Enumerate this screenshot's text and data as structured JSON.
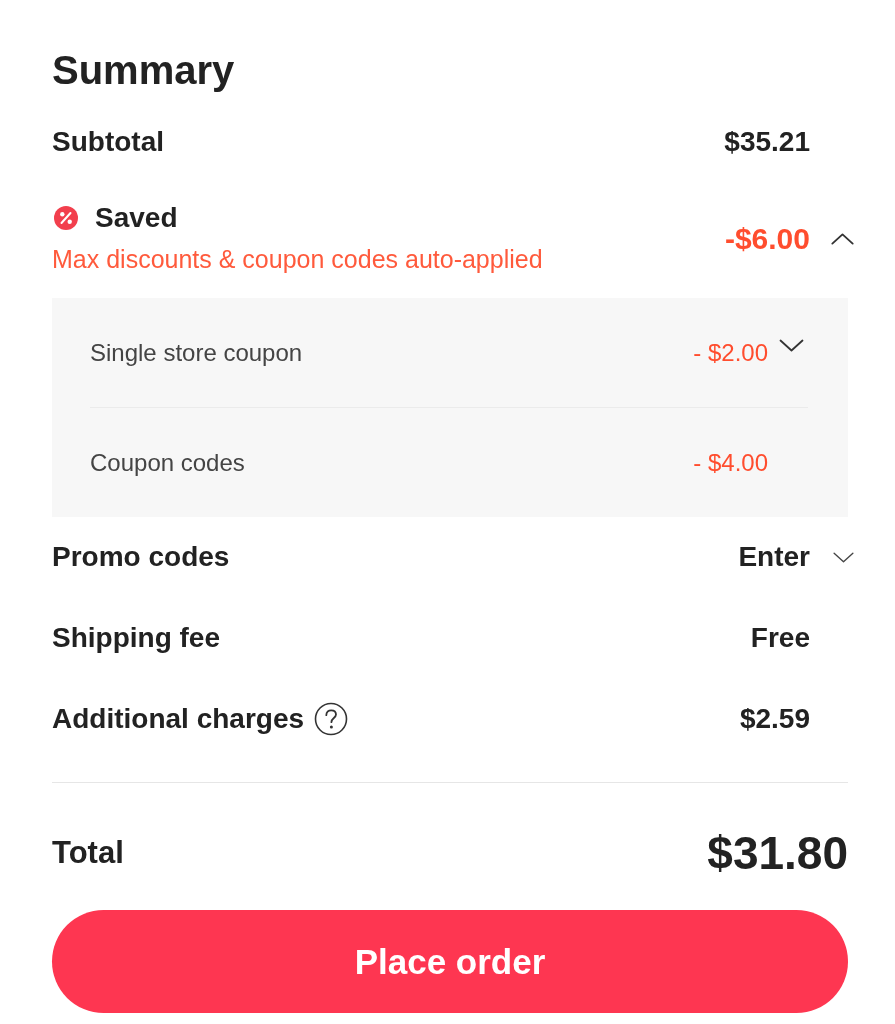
{
  "title": "Summary",
  "subtotal": {
    "label": "Subtotal",
    "value": "$35.21"
  },
  "savings": {
    "label": "Saved",
    "note": "Max discounts & coupon codes auto-applied",
    "value": "-$6.00",
    "expanded": true,
    "items": [
      {
        "kind": "expandable",
        "label": "Single store coupon",
        "value": "- $2.00"
      },
      {
        "kind": "plain",
        "label": "Coupon codes",
        "value": "- $4.00"
      }
    ]
  },
  "promo_codes": {
    "label": "Promo codes",
    "value": "Enter",
    "expanded": false
  },
  "shipping_fee": {
    "label": "Shipping fee",
    "value": "Free"
  },
  "additional_charges": {
    "label": "Additional charges",
    "value": "$2.59",
    "info": true
  },
  "total": {
    "label": "Total",
    "value": "$31.80"
  },
  "place_order_button": {
    "label": "Place order"
  }
}
